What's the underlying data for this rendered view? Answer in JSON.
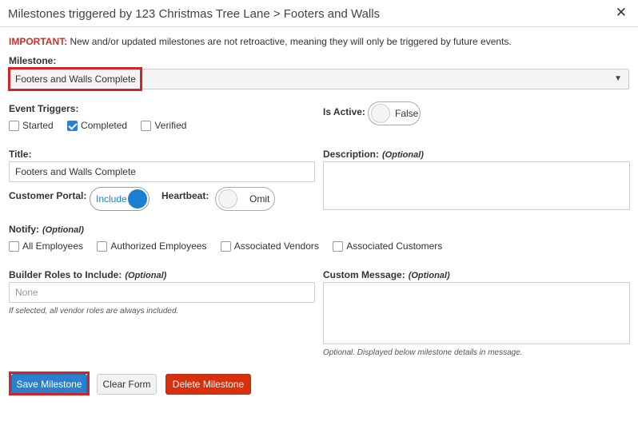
{
  "header": {
    "title": "Milestones triggered by 123 Christmas Tree Lane > Footers and Walls",
    "close_glyph": "✕"
  },
  "notice": {
    "important": "IMPORTANT:",
    "text": " New and/or updated milestones are not retroactive, meaning they will only be triggered by future events."
  },
  "milestone": {
    "label": "Milestone:",
    "value": "Footers and Walls Complete",
    "arrow": "▼"
  },
  "event_triggers": {
    "label": "Event Triggers:",
    "items": [
      {
        "label": "Started",
        "checked": false
      },
      {
        "label": "Completed",
        "checked": true
      },
      {
        "label": "Verified",
        "checked": false
      }
    ]
  },
  "is_active": {
    "label": "Is Active:",
    "state": "False"
  },
  "title_field": {
    "label": "Title:",
    "value": "Footers and Walls Complete"
  },
  "description": {
    "label": "Description:",
    "optional": "(Optional)"
  },
  "customer_portal": {
    "label": "Customer Portal:",
    "state": "Include"
  },
  "heartbeat": {
    "label": "Heartbeat:",
    "state": "Omit"
  },
  "notify": {
    "label": "Notify:",
    "optional": "(Optional)",
    "items": [
      {
        "label": "All Employees",
        "checked": false
      },
      {
        "label": "Authorized Employees",
        "checked": false
      },
      {
        "label": "Associated Vendors",
        "checked": false
      },
      {
        "label": "Associated Customers",
        "checked": false
      }
    ]
  },
  "builder_roles": {
    "label": "Builder Roles to Include:",
    "optional": "(Optional)",
    "placeholder": "None",
    "hint": "If selected, all vendor roles are always included."
  },
  "custom_message": {
    "label": "Custom Message:",
    "optional": "(Optional)",
    "hint": "Optional. Displayed below milestone details in message."
  },
  "buttons": {
    "save": "Save Milestone",
    "clear": "Clear Form",
    "delete": "Delete Milestone"
  },
  "colors": {
    "accent": "#2a7fcf",
    "danger": "#d6300f",
    "highlight": "#d42427",
    "important": "#c9302c"
  }
}
